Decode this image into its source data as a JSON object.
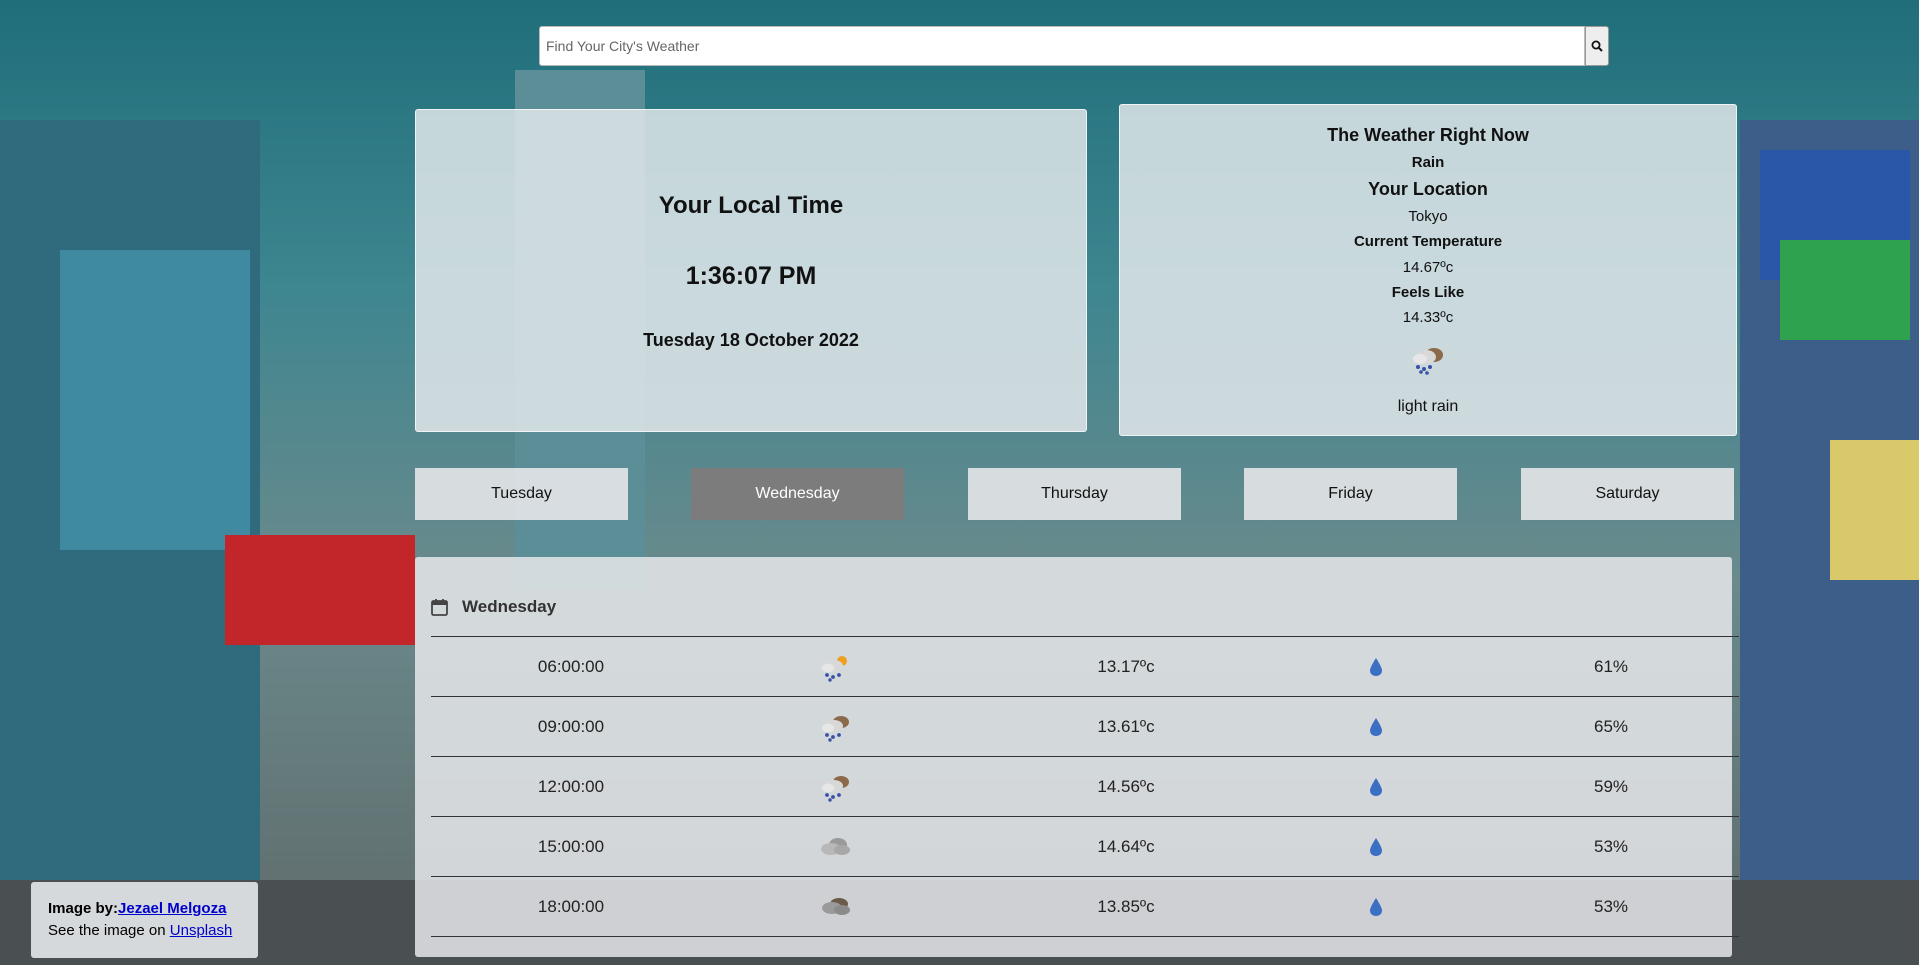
{
  "search": {
    "placeholder": "Find Your City's Weather",
    "value": "",
    "button_icon": "search-icon"
  },
  "local": {
    "title": "Your Local Time",
    "time": "1:36:07 PM",
    "date": "Tuesday 18 October 2022"
  },
  "now": {
    "title": "The Weather Right Now",
    "condition": "Rain",
    "location_label": "Your Location",
    "location": "Tokyo",
    "temp_label": "Current Temperature",
    "temp": "14.67ºc",
    "feels_label": "Feels Like",
    "feels": "14.33ºc",
    "icon": "rain-cloud-icon",
    "description": "light rain"
  },
  "days": [
    {
      "label": "Tuesday",
      "active": false
    },
    {
      "label": "Wednesday",
      "active": true
    },
    {
      "label": "Thursday",
      "active": false
    },
    {
      "label": "Friday",
      "active": false
    },
    {
      "label": "Saturday",
      "active": false
    }
  ],
  "forecast": {
    "day": "Wednesday",
    "header_icon": "calendar-icon",
    "rows": [
      {
        "time": "06:00:00",
        "icon": "sun-rain-cloud-icon",
        "temp": "13.17ºc",
        "humidity": "61%"
      },
      {
        "time": "09:00:00",
        "icon": "rain-cloud-icon",
        "temp": "13.61ºc",
        "humidity": "65%"
      },
      {
        "time": "12:00:00",
        "icon": "rain-cloud-icon",
        "temp": "14.56ºc",
        "humidity": "59%"
      },
      {
        "time": "15:00:00",
        "icon": "cloud-icon",
        "temp": "14.64ºc",
        "humidity": "53%"
      },
      {
        "time": "18:00:00",
        "icon": "dark-cloud-icon",
        "temp": "13.85ºc",
        "humidity": "53%"
      }
    ]
  },
  "credit": {
    "image_by_label": "Image by:",
    "author": "Jezael Melgoza",
    "see_label": "See the image on ",
    "site": "Unsplash"
  },
  "colors": {
    "active_tab": "#7c7c7c",
    "drop": "#3b6fc4",
    "link": "#0000cc"
  }
}
